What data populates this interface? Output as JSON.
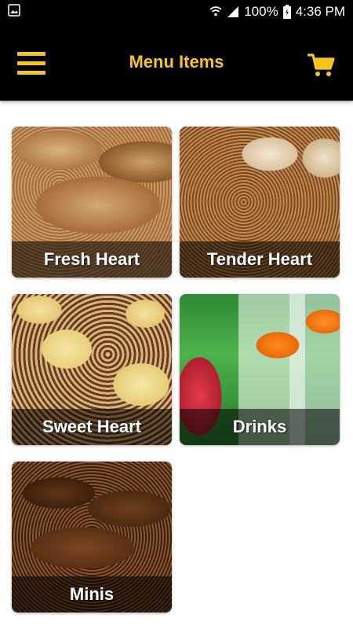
{
  "status_bar": {
    "battery": "100%",
    "time": "4:36 PM",
    "icons": [
      "image-icon",
      "wifi-icon",
      "signal-icon",
      "battery-icon"
    ]
  },
  "app_bar": {
    "title": "Menu Items",
    "accent_color": "#f5c518",
    "icons": [
      "hamburger-menu-icon",
      "cart-icon"
    ]
  },
  "menu": {
    "items": [
      {
        "label": "Fresh Heart"
      },
      {
        "label": "Tender Heart"
      },
      {
        "label": "Sweet Heart"
      },
      {
        "label": "Drinks"
      },
      {
        "label": "Minis"
      }
    ]
  }
}
